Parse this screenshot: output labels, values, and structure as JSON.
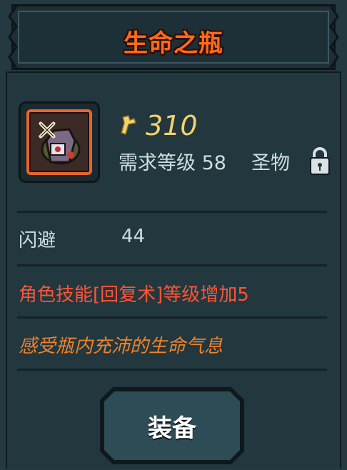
{
  "title": "生命之瓶",
  "item": {
    "icon": "bottle-relic-icon",
    "price": "310",
    "price_icon": "gold-key-icon",
    "requirement": "需求等级 58",
    "rarity": "圣物",
    "lock_icon": "lock-icon"
  },
  "stats": [
    {
      "label": "闪避",
      "value": "44"
    }
  ],
  "skill_bonus": "角色技能[回复术]等级增加5",
  "flavor_text": "感受瓶内充沛的生命气息",
  "actions": {
    "equip_label": "装备"
  },
  "colors": {
    "title": "#ff6a1a",
    "price": "#f4d26a",
    "skill": "#ff5436",
    "flavor": "#f0832b",
    "panel": "#243940"
  }
}
